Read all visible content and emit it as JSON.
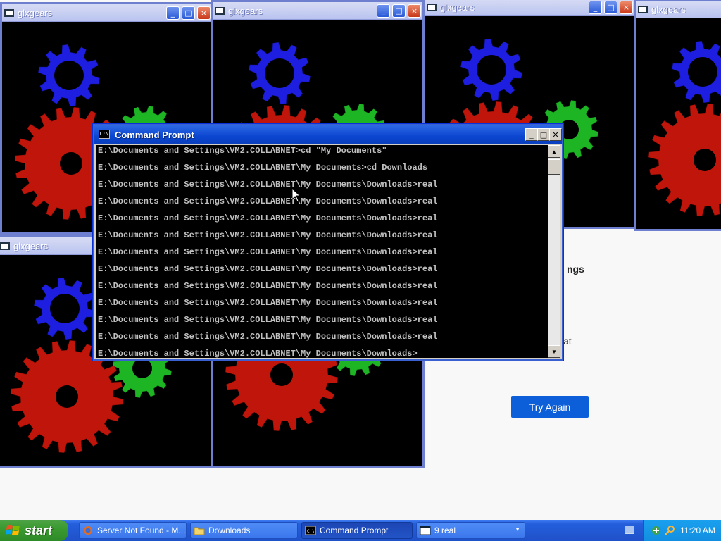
{
  "background_page": {
    "heading_fragment": "ngs",
    "text_fragment": "at",
    "try_again_label": "Try Again"
  },
  "glx_windows": [
    {
      "title": "glxgears"
    },
    {
      "title": "glxgears"
    },
    {
      "title": "glxgears"
    },
    {
      "title": "glxgears"
    },
    {
      "title": "glxgears"
    }
  ],
  "cmd": {
    "title": "Command Prompt",
    "icon_text": "C:\\",
    "lines": [
      "E:\\Documents and Settings\\VM2.COLLABNET>cd \"My Documents\"",
      "E:\\Documents and Settings\\VM2.COLLABNET\\My Documents>cd Downloads",
      "E:\\Documents and Settings\\VM2.COLLABNET\\My Documents\\Downloads>real",
      "E:\\Documents and Settings\\VM2.COLLABNET\\My Documents\\Downloads>real",
      "E:\\Documents and Settings\\VM2.COLLABNET\\My Documents\\Downloads>real",
      "E:\\Documents and Settings\\VM2.COLLABNET\\My Documents\\Downloads>real",
      "E:\\Documents and Settings\\VM2.COLLABNET\\My Documents\\Downloads>real",
      "E:\\Documents and Settings\\VM2.COLLABNET\\My Documents\\Downloads>real",
      "E:\\Documents and Settings\\VM2.COLLABNET\\My Documents\\Downloads>real",
      "E:\\Documents and Settings\\VM2.COLLABNET\\My Documents\\Downloads>real",
      "E:\\Documents and Settings\\VM2.COLLABNET\\My Documents\\Downloads>real",
      "E:\\Documents and Settings\\VM2.COLLABNET\\My Documents\\Downloads>real",
      "E:\\Documents and Settings\\VM2.COLLABNET\\My Documents\\Downloads>"
    ]
  },
  "taskbar": {
    "start_label": "start",
    "tasks": [
      {
        "label": "Server Not Found - M...",
        "icon": "firefox-icon"
      },
      {
        "label": "Downloads",
        "icon": "folder-icon"
      },
      {
        "label": "Command Prompt",
        "icon": "cmd-icon"
      },
      {
        "label": "9 real",
        "icon": "window-icon"
      }
    ],
    "clock": "11:20 AM"
  },
  "colors": {
    "gear_red": "#c0150a",
    "gear_green": "#1db524",
    "gear_blue": "#1d1ee0",
    "taskbar_blue": "#245edb",
    "start_green": "#3a9a2f"
  }
}
